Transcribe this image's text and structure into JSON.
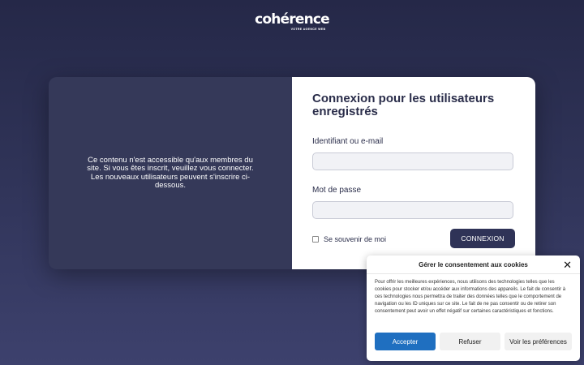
{
  "brand": {
    "logo_text": "cohérence",
    "tagline": "VOTRE AGENCE WEB"
  },
  "info_panel": {
    "message": "Ce contenu n'est accessible qu'aux membres du site. Si vous êtes inscrit, veuillez vous connecter. Les nouveaux utilisateurs peuvent s'inscrire ci-dessous."
  },
  "login": {
    "title": "Connexion pour les utilisateurs enregistrés",
    "username_label": "Identifiant ou e-mail",
    "username_value": "",
    "password_label": "Mot de passe",
    "password_value": "",
    "remember_label": "Se souvenir de moi",
    "submit_label": "CONNEXION"
  },
  "cookie_banner": {
    "title": "Gérer le consentement aux cookies",
    "close_icon": "close-icon",
    "text": "Pour offrir les meilleures expériences, nous utilisons des technologies telles que les cookies pour stocker et/ou accéder aux informations des appareils. Le fait de consentir à ces technologies nous permettra de traiter des données telles que le comportement de navigation ou les ID uniques sur ce site. Le fait de ne pas consentir ou de retirer son consentement peut avoir un effet négatif sur certaines caractéristiques et fonctions.",
    "accept_label": "Accepter",
    "refuse_label": "Refuser",
    "preferences_label": "Voir les préférences"
  },
  "colors": {
    "background": "#2f3357",
    "panel_dark": "#353959",
    "button_dark": "#2f3357",
    "accept_blue": "#1f6fc0"
  }
}
